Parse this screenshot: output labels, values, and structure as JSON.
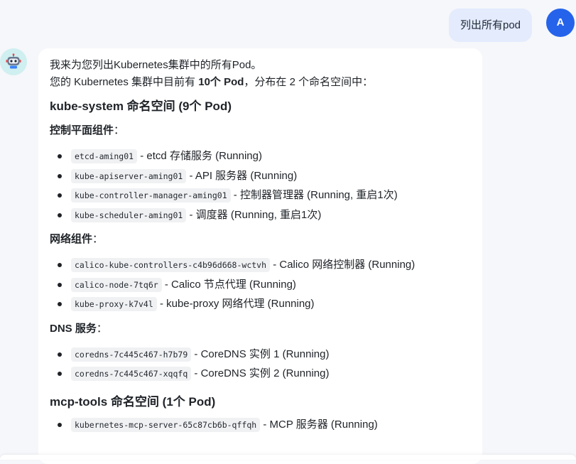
{
  "user_message": {
    "text": "列出所有pod",
    "avatar_letter": "A"
  },
  "bot": {
    "avatar_icon": "robot-icon",
    "intro_line": "我来为您列出Kubernetes集群中的所有Pod。",
    "summary": {
      "prefix": "您的 Kubernetes 集群中目前有 ",
      "count": "10个 Pod",
      "suffix": "，分布在 2 个命名空间中："
    },
    "sections": [
      {
        "title": "kube-system 命名空间 (9个 Pod)",
        "groups": [
          {
            "label": "控制平面组件",
            "colon": "：",
            "pods": [
              {
                "name": "etcd-aming01",
                "desc": " - etcd 存储服务 (Running)"
              },
              {
                "name": "kube-apiserver-aming01",
                "desc": " - API 服务器 (Running)"
              },
              {
                "name": "kube-controller-manager-aming01",
                "desc": " - 控制器管理器 (Running, 重启1次)"
              },
              {
                "name": "kube-scheduler-aming01",
                "desc": " - 调度器 (Running, 重启1次)"
              }
            ]
          },
          {
            "label": "网络组件",
            "colon": "：",
            "pods": [
              {
                "name": "calico-kube-controllers-c4b96d668-wctvh",
                "desc": " - Calico 网络控制器 (Running)"
              },
              {
                "name": "calico-node-7tq6r",
                "desc": " - Calico 节点代理 (Running)"
              },
              {
                "name": "kube-proxy-k7v4l",
                "desc": " - kube-proxy 网络代理 (Running)"
              }
            ]
          },
          {
            "label": "DNS 服务",
            "colon": "：",
            "pods": [
              {
                "name": "coredns-7c445c467-h7b79",
                "desc": " - CoreDNS 实例 1 (Running)"
              },
              {
                "name": "coredns-7c445c467-xqqfq",
                "desc": " - CoreDNS 实例 2 (Running)"
              }
            ]
          }
        ]
      },
      {
        "title": "mcp-tools 命名空间 (1个 Pod)",
        "groups": [
          {
            "label": "",
            "colon": "",
            "pods": [
              {
                "name": "kubernetes-mcp-server-65c87cb6b-qffqh",
                "desc": " - MCP 服务器 (Running)"
              }
            ]
          }
        ]
      }
    ]
  },
  "colors": {
    "page_bg": "#f5f7fa",
    "user_bubble": "#e3ebfd",
    "user_avatar": "#2563eb",
    "bot_avatar_bg": "#cfeff0",
    "code_bg": "#f0f1f3"
  }
}
